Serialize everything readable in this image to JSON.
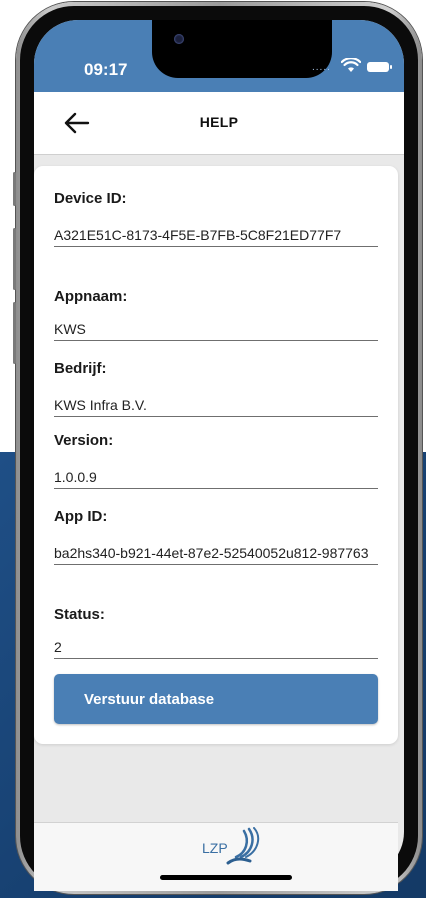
{
  "status_bar": {
    "time": "09:17",
    "signal": ".....",
    "wifi_icon": "wifi-icon",
    "battery_icon": "battery-icon"
  },
  "header": {
    "title": "HELP",
    "back_icon": "arrow-left-icon"
  },
  "fields": [
    {
      "label": "Device ID:",
      "value": "A321E51C-8173-4F5E-B7FB-5C8F21ED77F7"
    },
    {
      "label": "Appnaam:",
      "value": "KWS"
    },
    {
      "label": "Bedrijf:",
      "value": "KWS Infra B.V."
    },
    {
      "label": "Version:",
      "value": "1.0.0.9"
    },
    {
      "label": "App ID:",
      "value": "ba2hs340-b921-44et-87e2-52540052u812-987763"
    },
    {
      "label": "Status:",
      "value": "2"
    }
  ],
  "actions": {
    "send_database_label": "Verstuur database"
  },
  "footer": {
    "logo_text": "LZP",
    "logo_icon": "lzp-logo-icon"
  },
  "colors": {
    "accent": "#4a7fb5",
    "background": "#e9e9e9",
    "backdrop": "#1f4f86"
  }
}
